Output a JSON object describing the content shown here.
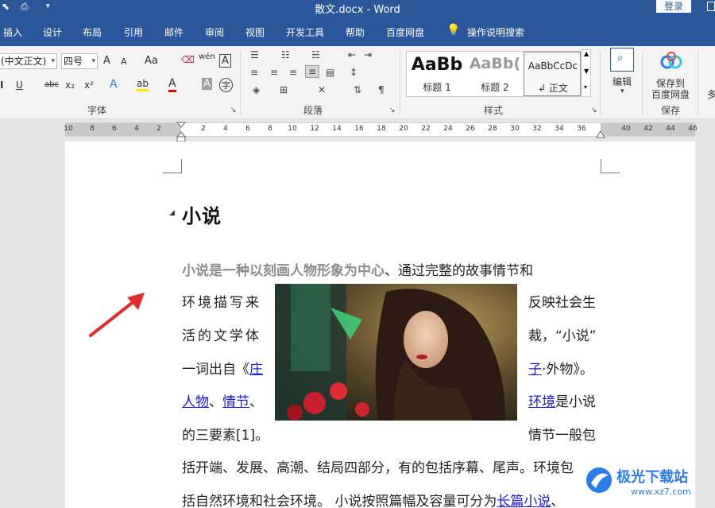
{
  "title_bar": {
    "doc_title": "散文.docx  -  Word",
    "login": "登录",
    "qa_icons": [
      "cursor-select-icon",
      "print-preview-icon",
      "customize-arrow-icon"
    ]
  },
  "menu_tabs": [
    "插入",
    "设计",
    "布局",
    "引用",
    "邮件",
    "审阅",
    "视图",
    "开发工具",
    "帮助",
    "百度网盘"
  ],
  "tell_me": "操作说明搜索",
  "ribbon": {
    "font": {
      "font_name": "(中文正文)",
      "font_size": "四号",
      "grow": "A",
      "shrink": "A",
      "case": "Aa",
      "phonetic": "wén",
      "border_char": "A",
      "underline": "U",
      "strike": "abc",
      "sub": "x₂",
      "sup": "x²",
      "effect": "A",
      "highlight": "ab",
      "color": "A",
      "shading": "A",
      "enclose": "字",
      "label": "字体"
    },
    "paragraph": {
      "label": "段落"
    },
    "styles": {
      "items": [
        {
          "sample": "AaBb",
          "name": "标题 1"
        },
        {
          "sample": "AaBb(",
          "name": "标题 2"
        },
        {
          "sample": "AaBbCcDc",
          "name": "↲ 正文"
        }
      ],
      "label": "样式"
    },
    "edit": {
      "label": "编辑"
    },
    "save": {
      "line1": "保存到",
      "line2": "百度网盘",
      "label": "保存"
    },
    "more": "多"
  },
  "ruler": {
    "numbers": [
      "10",
      "8",
      "6",
      "4",
      "2",
      "2",
      "4",
      "6",
      "8",
      "10",
      "12",
      "14",
      "16",
      "18",
      "20",
      "22",
      "24",
      "26",
      "28",
      "30",
      "32",
      "34",
      "36",
      "40",
      "42",
      "44",
      "46"
    ]
  },
  "document": {
    "heading": "小说",
    "lines": [
      {
        "parts": [
          {
            "t": "小说是一种以刻画人物形象为中心",
            "style": "grayb"
          },
          {
            "t": "、通过完整的故事情节和"
          }
        ]
      },
      {
        "left": "环境描写来",
        "right": "反映社会生"
      },
      {
        "left": "活的文学体",
        "right": "裁，“小说”"
      },
      {
        "left_parts": [
          {
            "t": "一词出自《"
          },
          {
            "t": "庄",
            "style": "link"
          }
        ],
        "right_parts": [
          {
            "t": "子",
            "style": "link"
          },
          {
            "t": "·外物》。"
          }
        ]
      },
      {
        "left_parts": [
          {
            "t": "人物",
            "style": "link"
          },
          {
            "t": "、"
          },
          {
            "t": "情节",
            "style": "link"
          },
          {
            "t": "、"
          }
        ],
        "right_parts": [
          {
            "t": "环境",
            "style": "link"
          },
          {
            "t": "是小说"
          }
        ]
      },
      {
        "left": "的三要素[1]。",
        "right": "情节一般包"
      },
      {
        "parts": [
          {
            "t": "括开端、发展、高潮、结局四部分，有的包括序幕、尾声。环境包"
          }
        ]
      },
      {
        "parts": [
          {
            "t": "括自然环境和社会环境。 小说按照篇幅及容量可分为"
          },
          {
            "t": "长篇小说",
            "style": "link"
          },
          {
            "t": "、"
          }
        ]
      }
    ]
  },
  "watermark": {
    "text": "极光下载站",
    "url": "www.xz7.com"
  },
  "colors": {
    "brand": "#2b579a",
    "link": "#1a1ae6",
    "arrow": "#e32b2b"
  }
}
